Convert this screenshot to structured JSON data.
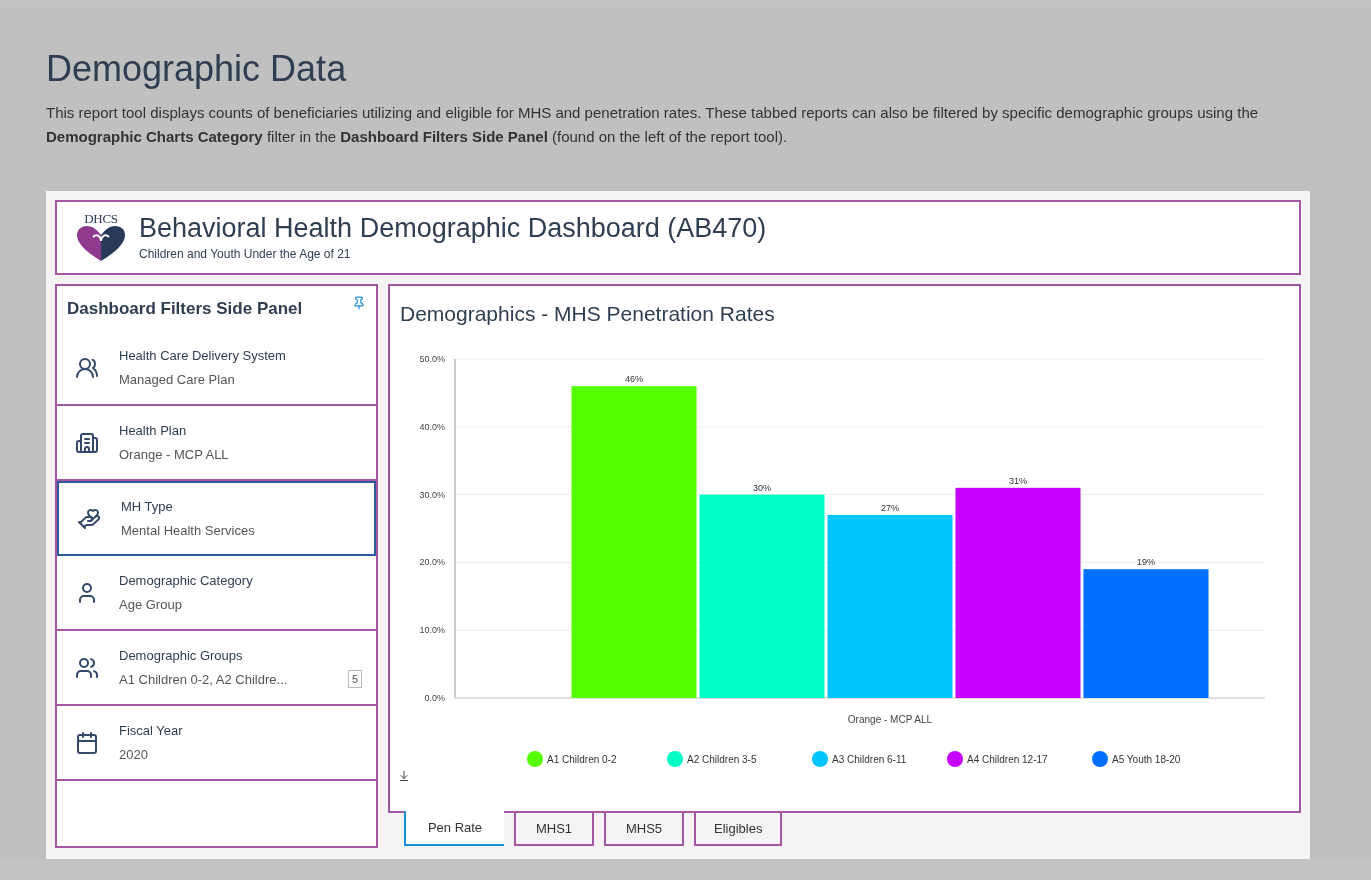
{
  "page": {
    "title": "Demographic Data",
    "intro": "This report tool displays counts of beneficiaries utilizing and eligible for MHS and penetration rates.  These tabbed reports can also be filtered by specific demographic groups using the **Demographic Charts Category** filter in the **Dashboard Filters Side Panel** (found on the left of the report tool)."
  },
  "dashboard": {
    "logo_text": "DHCS",
    "title": "Behavioral Health Demographic Dashboard (AB470)",
    "subtitle": "Children and Youth Under the Age of 21"
  },
  "side_panel": {
    "title": "Dashboard Filters Side Panel",
    "filters": [
      {
        "kind": "delivery",
        "label": "Health Care Delivery System",
        "value": "Managed Care Plan",
        "selected": false
      },
      {
        "kind": "plan",
        "label": "Health Plan",
        "value": "Orange - MCP ALL",
        "selected": false
      },
      {
        "kind": "mhtype",
        "label": "MH Type",
        "value": "Mental Health Services",
        "selected": true
      },
      {
        "kind": "category",
        "label": "Demographic Category",
        "value": "Age Group",
        "selected": false
      },
      {
        "kind": "groups",
        "label": "Demographic Groups",
        "value": "A1 Children 0-2, A2 Childre...",
        "count": "5",
        "selected": false
      },
      {
        "kind": "year",
        "label": "Fiscal Year",
        "value": "2020",
        "selected": false
      }
    ]
  },
  "chart_panel": {
    "title": "Demographics - MHS Penetration Rates",
    "chart_data": {
      "type": "bar",
      "categories": [
        "Orange - MCP ALL"
      ],
      "series": [
        {
          "name": "A1 Children 0-2",
          "color": "#55ff00",
          "values": [
            46
          ]
        },
        {
          "name": "A2 Children 3-5",
          "color": "#00ffc5",
          "values": [
            30
          ]
        },
        {
          "name": "A3 Children 6-11",
          "color": "#00c5ff",
          "values": [
            27
          ]
        },
        {
          "name": "A4 Children 12-17",
          "color": "#c500ff",
          "values": [
            31
          ]
        },
        {
          "name": "A5 Youth 18-20",
          "color": "#0070ff",
          "values": [
            19
          ]
        }
      ],
      "ylim": [
        0,
        50
      ],
      "yticks": [
        {
          "value": 0,
          "label": "0.0%"
        },
        {
          "value": 10,
          "label": "10.0%"
        },
        {
          "value": 20,
          "label": "20.0%"
        },
        {
          "value": 30,
          "label": "30.0%"
        },
        {
          "value": 40,
          "label": "40.0%"
        },
        {
          "value": 50,
          "label": "50.0%"
        }
      ],
      "grid": true,
      "legend": true,
      "value_labels": [
        [
          "46%"
        ],
        [
          "30%"
        ],
        [
          "27%"
        ],
        [
          "31%"
        ],
        [
          "19%"
        ]
      ]
    }
  },
  "tabs": [
    {
      "label": "Pen Rate",
      "selected": true
    },
    {
      "label": "MHS1",
      "selected": false
    },
    {
      "label": "MHS5",
      "selected": false
    },
    {
      "label": "Eligibles",
      "selected": false
    }
  ]
}
